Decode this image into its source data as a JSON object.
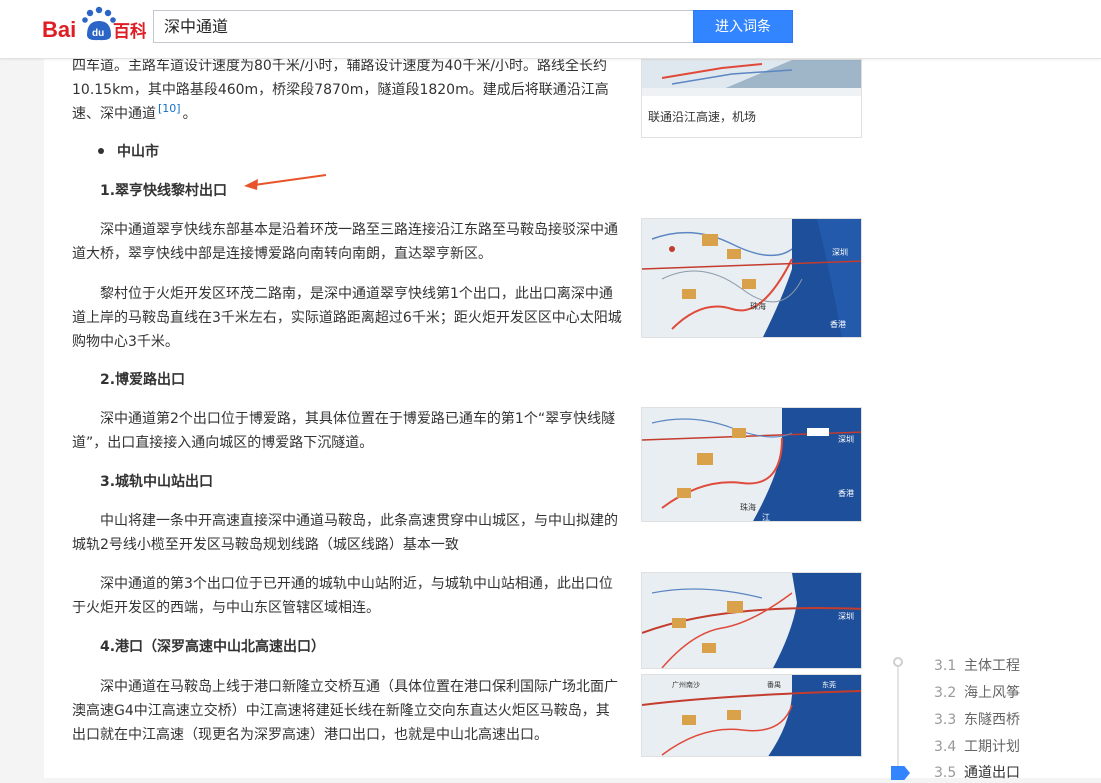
{
  "header": {
    "logo_text_1": "Bai",
    "logo_paw_text": "du",
    "logo_text_2": "百科",
    "search_value": "深中通道",
    "search_button": "进入词条"
  },
  "article": {
    "intro_para": "四车道。主路车道设计速度为80千米/小时，辅路设计速度为40千米/小时。路线全长约10.15km，其中路基段460m，桥梁段7870m，隧道段1820m。建成后将联通沿江高速、深中通道",
    "intro_ref": "[10]",
    "intro_end": "。",
    "bullet_zhongshan": "中山市",
    "h1": "1.翠亨快线黎村出口",
    "p1": "深中通道翠亨快线东部基本是沿着环茂一路至三路连接沿江东路至马鞍岛接驳深中通道大桥，翠亨快线中部是连接博爱路向南转向南朗，直达翠亨新区。",
    "p2": "黎村位于火炬开发区环茂二路南，是深中通道翠亨快线第1个出口，此出口离深中通道上岸的马鞍岛直线在3千米左右，实际道路距离超过6千米；距火炬开发区区中心太阳城购物中心3千米。",
    "h2": "2.博爱路出口",
    "p3": "深中通道第2个出口位于博爱路，其具体位置在于博爱路已通车的第1个“翠亨快线隧道”，出口直接接入通向城区的博爱路下沉隧道。",
    "h3": "3.城轨中山站出口",
    "p4": "中山将建一条中开高速直接深中通道马鞍岛，此条高速贯穿中山城区，与中山拟建的城轨2号线小榄至开发区马鞍岛规划线路（城区线路）基本一致",
    "p5": "深中通道的第3个出口位于已开通的城轨中山站附近，与城轨中山站相通，此出口位于火炬开发区的西端，与中山东区管辖区域相连。",
    "h4_bold": "4.港口（深罗高速中山北高速出口）",
    "p6": "深中通道在马鞍岛上线于港口新隆立交桥互通（具体位置在港口保利国际广场北面广澳高速G4中江高速立交桥）中江高速将建延长线在新隆立交向东直达火炬区马鞍岛，其出口就在中江高速（现更名为深罗高速）港口出口，也就是中山北高速出口。"
  },
  "figures": {
    "caption_top": "联通沿江高速，机场",
    "map_label_shenzhen": "深圳",
    "map_label_zhuhai": "珠海",
    "map_label_hongkong": "香港",
    "map_label_dongguan": "东莞",
    "map_label_jiang": "江",
    "map_label_guangzhou": "广州南沙",
    "map_label_jiangmen": "番禺"
  },
  "toc": {
    "items": [
      {
        "num": "3.1",
        "label": "主体工程"
      },
      {
        "num": "3.2",
        "label": "海上风筝"
      },
      {
        "num": "3.3",
        "label": "东隧西桥"
      },
      {
        "num": "3.4",
        "label": "工期计划"
      },
      {
        "num": "3.5",
        "label": "通道出口"
      }
    ]
  },
  "colors": {
    "brand_red": "#de1d24",
    "brand_blue": "#2b65c6",
    "button_blue": "#3385ff",
    "sea": "#1d4f9b",
    "arrow": "#e8542a"
  }
}
